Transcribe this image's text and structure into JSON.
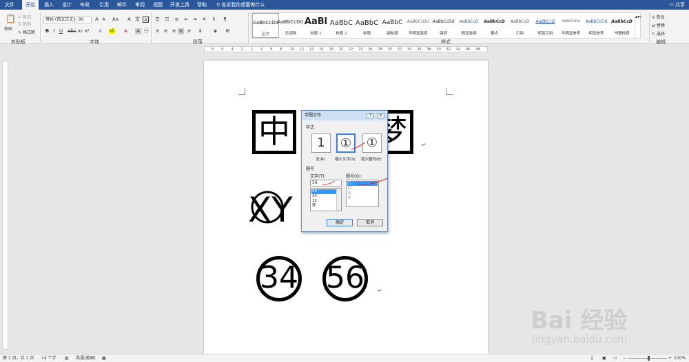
{
  "tabs": [
    "文件",
    "开始",
    "插入",
    "设计",
    "布局",
    "引用",
    "邮件",
    "审阅",
    "视图",
    "开发工具",
    "帮助"
  ],
  "tell_me": "告诉我你想要做什么",
  "share": "共享",
  "clipboard": {
    "paste": "粘贴",
    "cut": "剪切",
    "copy": "复制",
    "format_painter": "格式刷",
    "label": "剪贴板"
  },
  "font": {
    "name": "等线 (西文正文)",
    "size": "90",
    "label": "字体"
  },
  "paragraph": {
    "label": "段落"
  },
  "styles": {
    "label": "样式",
    "items": [
      {
        "sample": "AaBbCcDd",
        "name": "正文"
      },
      {
        "sample": "AaBbCcDd",
        "name": "无间隔"
      },
      {
        "sample": "AaBl",
        "name": "标题 1"
      },
      {
        "sample": "AaBbC",
        "name": "标题 2"
      },
      {
        "sample": "AaBbC",
        "name": "标题"
      },
      {
        "sample": "AaBbC",
        "name": "副标题"
      },
      {
        "sample": "AaBbCcDd",
        "name": "不明显强调"
      },
      {
        "sample": "AaBbCcDd",
        "name": "强调"
      },
      {
        "sample": "AaBbCcD",
        "name": "明显强调"
      },
      {
        "sample": "AaBbCcD",
        "name": "要点"
      },
      {
        "sample": "AaBbCcD",
        "name": "引用"
      },
      {
        "sample": "AaBbCcD",
        "name": "明显引用"
      },
      {
        "sample": "AaBbCcDd",
        "name": "不明显参考"
      },
      {
        "sample": "AaBbCcDd",
        "name": "明显参考"
      },
      {
        "sample": "AaBbCcD",
        "name": "书籍标题"
      }
    ]
  },
  "editing": {
    "find": "查找",
    "replace": "替换",
    "select": "选择",
    "label": "编辑"
  },
  "ruler": [
    "8",
    "6",
    "4",
    "2",
    "2",
    "4",
    "6",
    "8",
    "10",
    "12",
    "14",
    "16",
    "18",
    "20",
    "22",
    "24",
    "26",
    "28",
    "30",
    "32",
    "34",
    "36",
    "38",
    "40",
    "42",
    "44",
    "46",
    "48"
  ],
  "document": {
    "box_chars": [
      "中",
      "梦"
    ],
    "overlay_text": "XY",
    "circled": [
      "34",
      "56"
    ]
  },
  "dialog": {
    "title": "带圈字符",
    "help": "?",
    "close": "×",
    "style_label": "样式",
    "options": [
      {
        "glyph": "1",
        "label": "无(N)"
      },
      {
        "glyph": "①",
        "label": "缩小文字(S)"
      },
      {
        "glyph": "①",
        "label": "增大圈号(E)"
      }
    ],
    "enclosure_label": "圈号",
    "text_label": "文字(T):",
    "text_value": "56",
    "text_list": [
      "56",
      "34",
      "12",
      "梦"
    ],
    "ring_label": "圈号(O):",
    "ring_list": [
      "○",
      "□",
      "△",
      "◇"
    ],
    "ok": "确定",
    "cancel": "取消"
  },
  "status": {
    "page": "第 1 页，共 1 页",
    "words": "14 个字",
    "lang": "英语(美国)",
    "zoom": "100%"
  },
  "watermark": {
    "main": "Bai 经验",
    "sub": "jingyan.baidu.com"
  }
}
